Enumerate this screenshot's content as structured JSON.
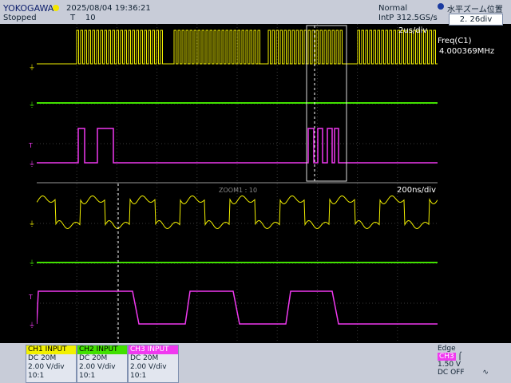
{
  "header": {
    "brand": "YOKOGAWA",
    "timestamp": "2025/08/04 19:36:21",
    "status": "Stopped",
    "trigger_count_label": "T",
    "trigger_count": "10",
    "acq_mode": "Normal",
    "sample_rate": "IntP  312.5GS/s",
    "zoom_position_label": "水平ズーム位置",
    "zoom_position_value": "2. 26div"
  },
  "measurements": {
    "freq_label": "Freq(C1)",
    "freq_value": "4.000369MHz"
  },
  "main_window": {
    "timebase": "2us/div"
  },
  "zoom_window": {
    "label": "ZOOM1 : 10",
    "timebase": "200ns/div"
  },
  "channels": [
    {
      "name": "CH1 INPUT",
      "coupling": "DC 20M",
      "scale": "2.00 V/div",
      "probe": "10:1",
      "color": "#f2f000"
    },
    {
      "name": "CH2 INPUT",
      "coupling": "DC 20M",
      "scale": "2.00 V/div",
      "probe": "10:1",
      "color": "#41e000"
    },
    {
      "name": "CH3 INPUT",
      "coupling": "DC 20M",
      "scale": "2.00 V/div",
      "probe": "10:1",
      "color": "#f039f0"
    }
  ],
  "trigger": {
    "type": "Edge",
    "source": "CH3",
    "level": "1.50 V",
    "coupling": "DC OFF"
  },
  "colors": {
    "background": "#000000",
    "grid": "#3a3a3a",
    "ch1": "#f2f000",
    "ch2": "#41e000",
    "ch3": "#f039f0"
  }
}
